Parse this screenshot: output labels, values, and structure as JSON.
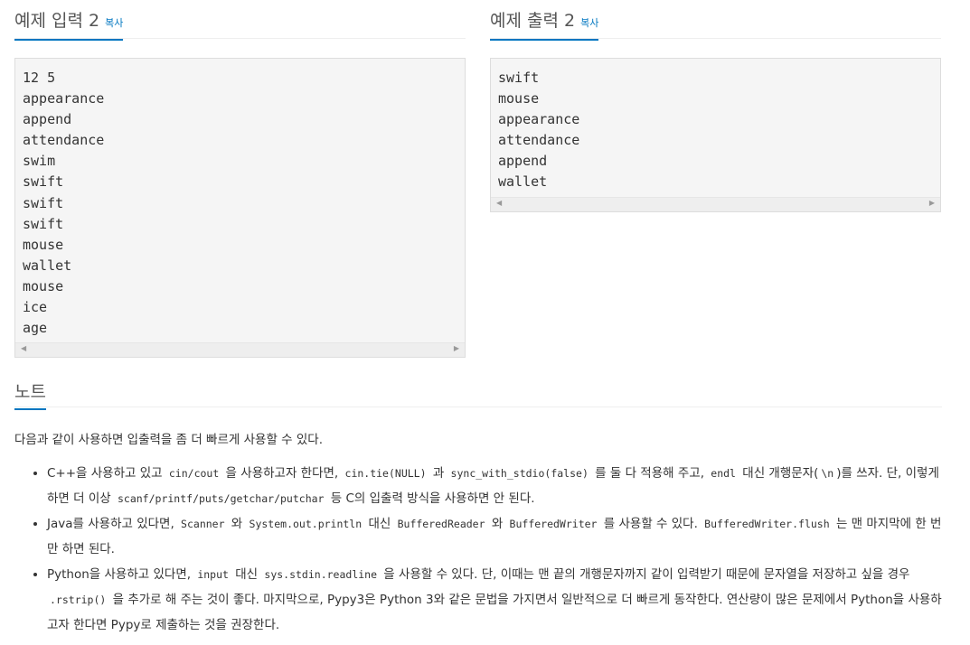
{
  "input": {
    "title": "예제 입력 2",
    "copy_label": "복사",
    "lines": [
      "12 5",
      "appearance",
      "append",
      "attendance",
      "swim",
      "swift",
      "swift",
      "swift",
      "mouse",
      "wallet",
      "mouse",
      "ice",
      "age"
    ]
  },
  "output": {
    "title": "예제 출력 2",
    "copy_label": "복사",
    "lines": [
      "swift",
      "mouse",
      "appearance",
      "attendance",
      "append",
      "wallet"
    ]
  },
  "note": {
    "title": "노트",
    "intro": "다음과 같이 사용하면 입출력을 좀 더 빠르게 사용할 수 있다.",
    "items": [
      {
        "segments": [
          {
            "t": "C++을 사용하고 있고 "
          },
          {
            "c": "cin/cout"
          },
          {
            "t": " 을 사용하고자 한다면, "
          },
          {
            "c": "cin.tie(NULL)"
          },
          {
            "t": " 과 "
          },
          {
            "c": "sync_with_stdio(false)"
          },
          {
            "t": " 를 둘 다 적용해 주고, "
          },
          {
            "c": "endl"
          },
          {
            "t": " 대신 개행문자("
          },
          {
            "c": "\\n"
          },
          {
            "t": ")를 쓰자. 단, 이렇게 하면 더 이상 "
          },
          {
            "c": "scanf/printf/puts/getchar/putchar"
          },
          {
            "t": " 등 C의 입출력 방식을 사용하면 안 된다."
          }
        ]
      },
      {
        "segments": [
          {
            "t": "Java를 사용하고 있다면, "
          },
          {
            "c": "Scanner"
          },
          {
            "t": " 와 "
          },
          {
            "c": "System.out.println"
          },
          {
            "t": " 대신 "
          },
          {
            "c": "BufferedReader"
          },
          {
            "t": " 와 "
          },
          {
            "c": "BufferedWriter"
          },
          {
            "t": " 를 사용할 수 있다. "
          },
          {
            "c": "BufferedWriter.flush"
          },
          {
            "t": " 는 맨 마지막에 한 번만 하면 된다."
          }
        ]
      },
      {
        "segments": [
          {
            "t": "Python을 사용하고 있다면, "
          },
          {
            "c": "input"
          },
          {
            "t": " 대신 "
          },
          {
            "c": "sys.stdin.readline"
          },
          {
            "t": " 을 사용할 수 있다. 단, 이때는 맨 끝의 개행문자까지 같이 입력받기 때문에 문자열을 저장하고 싶을 경우 "
          },
          {
            "c": ".rstrip()"
          },
          {
            "t": " 을 추가로 해 주는 것이 좋다. 마지막으로, Pypy3은 Python 3와 같은 문법을 가지면서 일반적으로 더 빠르게 동작한다. 연산량이 많은 문제에서 Python을 사용하고자 한다면 Pypy로 제출하는 것을 권장한다."
          }
        ]
      }
    ]
  },
  "colors": {
    "accent": "#0076c0",
    "pre_bg": "#f5f5f5"
  }
}
